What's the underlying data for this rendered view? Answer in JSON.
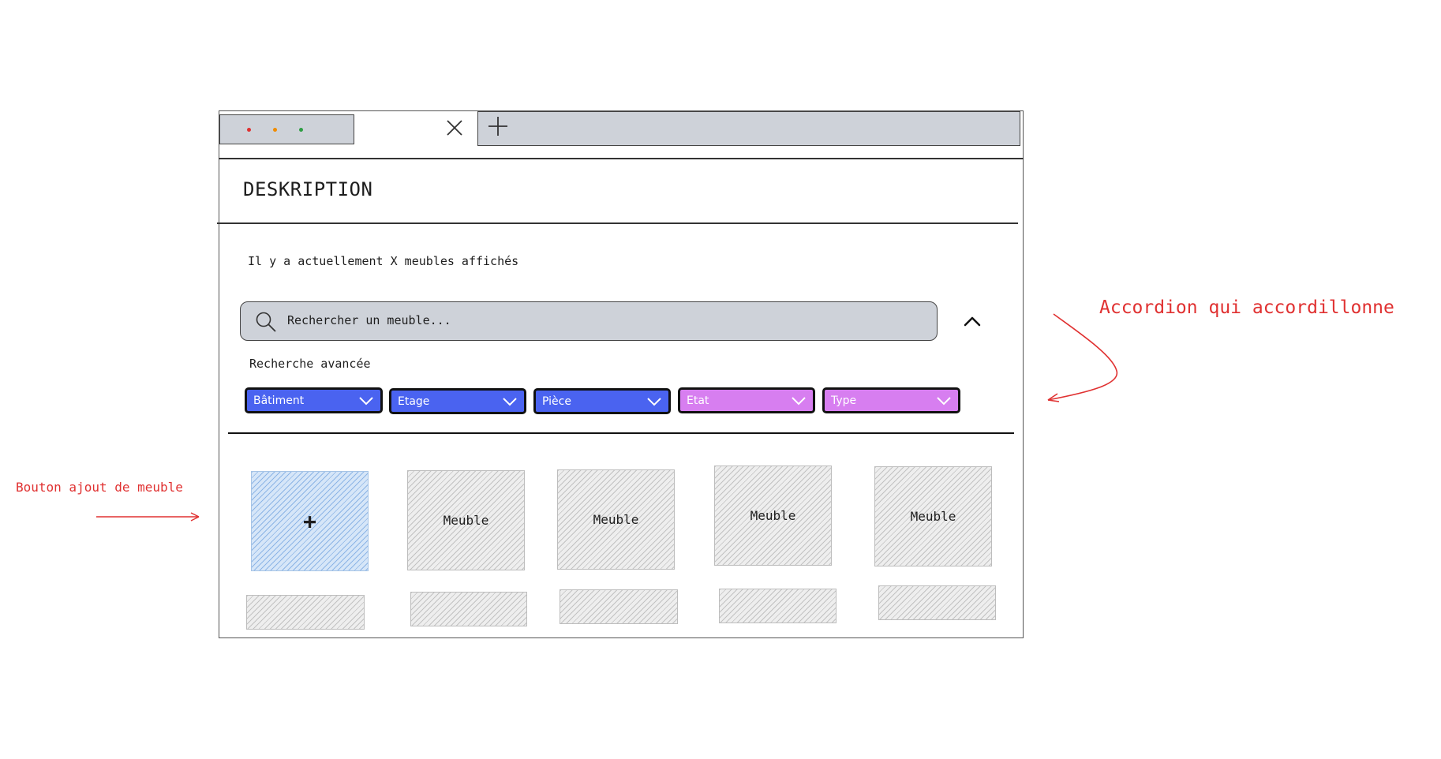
{
  "window": {
    "traffic_lights": [
      "#e03131",
      "#f08c00",
      "#2f9e44"
    ]
  },
  "header": {
    "title": "DESKRIPTION"
  },
  "main": {
    "count_text": "Il y a actuellement X meubles affichés",
    "search": {
      "placeholder": "Rechercher un meuble..."
    },
    "advanced_label": "Recherche avancée",
    "filters": [
      {
        "label": "Bâtiment",
        "color": "#4a63f0"
      },
      {
        "label": "Etage",
        "color": "#4a63f0"
      },
      {
        "label": "Pièce",
        "color": "#4a63f0"
      },
      {
        "label": "Etat",
        "color": "#d77ef0"
      },
      {
        "label": "Type",
        "color": "#d77ef0"
      }
    ],
    "add_button_label": "+",
    "cards": [
      {
        "label": "Meuble"
      },
      {
        "label": "Meuble"
      },
      {
        "label": "Meuble"
      },
      {
        "label": "Meuble"
      }
    ]
  },
  "annotations": {
    "accordion": "Accordion qui accordillonne",
    "add_button": "Bouton ajout de meuble"
  },
  "icons": [
    "close-icon",
    "plus-icon",
    "search-icon",
    "chevron-up-icon",
    "chevron-down-icon",
    "arrow-icon"
  ]
}
